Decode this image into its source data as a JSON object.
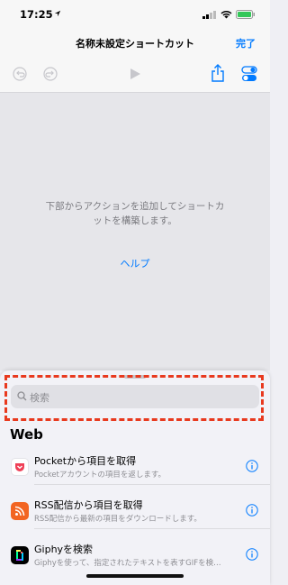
{
  "status": {
    "time": "17:25"
  },
  "nav": {
    "title": "名称未設定ショートカット",
    "done": "完了"
  },
  "canvas": {
    "empty_message": "下部からアクションを追加してショートカットを構築します。",
    "help": "ヘルプ"
  },
  "sheet": {
    "search_placeholder": "検索",
    "section": "Web",
    "rows": [
      {
        "title": "Pocketから項目を取得",
        "subtitle": "Pocketアカウントの項目を返します。",
        "icon": "pocket-icon",
        "color": "#ef3f56"
      },
      {
        "title": "RSS配信から項目を取得",
        "subtitle": "RSS配信から最新の項目をダウンロードします。",
        "icon": "rss-icon",
        "color": "#f26522"
      },
      {
        "title": "Giphyを検索",
        "subtitle": "Giphyを使って、指定されたテキストを表すGIFを検…",
        "icon": "giphy-icon",
        "color": "#000000"
      }
    ]
  },
  "colors": {
    "accent": "#007aff",
    "highlight": "#e8391e"
  }
}
